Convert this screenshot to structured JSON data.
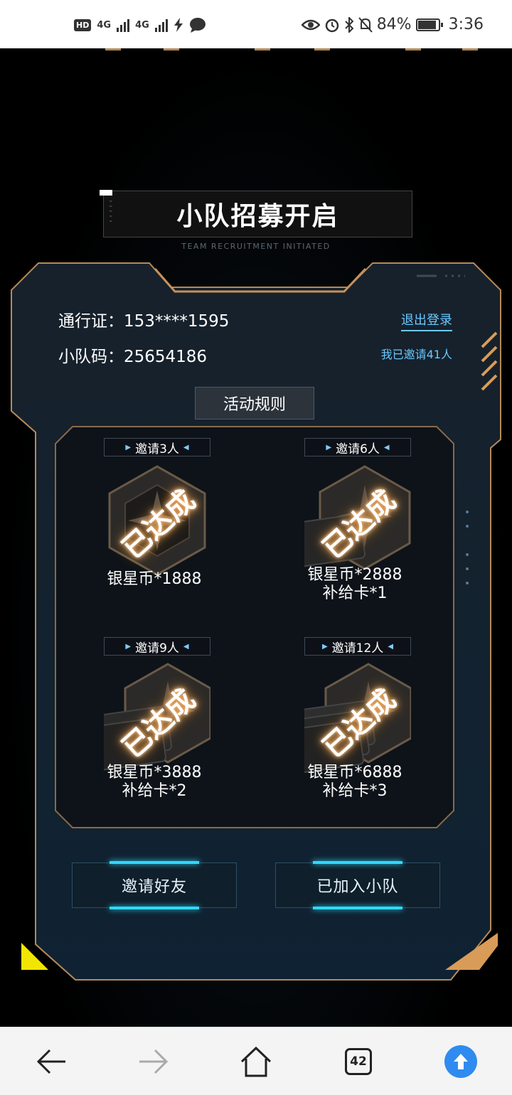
{
  "status_bar": {
    "net1": "4G",
    "net2": "4G",
    "battery": "84%",
    "time": "3:36"
  },
  "header": {
    "title": "小队招募开启",
    "subtitle": "TEAM RECRUITMENT INITIATED"
  },
  "account": {
    "pass_label": "通行证：",
    "pass_value": "153****1595",
    "team_label": "小队码：",
    "team_value": "25654186",
    "logout": "退出登录",
    "invited": "我已邀请41人"
  },
  "rules_button": "活动规则",
  "rewards": [
    {
      "tag": "邀请3人",
      "status": "已达成",
      "line1": "银星币*1888",
      "line2": ""
    },
    {
      "tag": "邀请6人",
      "status": "已达成",
      "line1": "银星币*2888",
      "line2": "补给卡*1"
    },
    {
      "tag": "邀请9人",
      "status": "已达成",
      "line1": "银星币*3888",
      "line2": "补给卡*2"
    },
    {
      "tag": "邀请12人",
      "status": "已达成",
      "line1": "银星币*6888",
      "line2": "补给卡*3"
    }
  ],
  "buttons": {
    "invite": "邀请好友",
    "joined": "已加入小队"
  },
  "browser_nav": {
    "tab_count": "42",
    "icons": [
      "back-arrow-icon",
      "forward-arrow-icon",
      "home-icon",
      "tabs-icon",
      "upload-arrow-icon"
    ]
  },
  "colors": {
    "accent_gold": "#c8905a",
    "accent_cyan": "#2fd9ff",
    "link_blue": "#69c8ff",
    "yellow_corner": "#f2e600"
  }
}
